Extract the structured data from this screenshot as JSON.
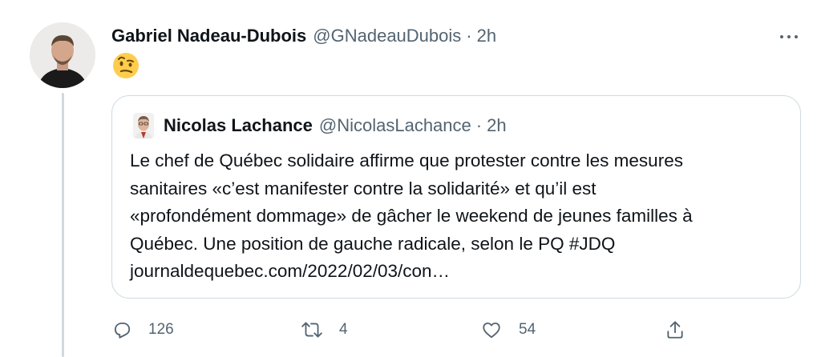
{
  "tweet": {
    "display_name": "Gabriel Nadeau-Dubois",
    "handle": "@GNadeauDubois",
    "separator": "·",
    "time": "2h",
    "emoji": "face-with-raised-eyebrow-emoji",
    "avatar": "profile-photo"
  },
  "quote": {
    "display_name": "Nicolas Lachance",
    "handle": "@NicolasLachance",
    "separator": "·",
    "time": "2h",
    "lines": [
      "Le chef de Québec solidaire affirme que protester contre les mesures",
      "sanitaires «c’est manifester contre la solidarité» et qu’il est",
      "«profondément dommage» de gâcher le weekend de jeunes familles à",
      "Québec. Une position de gauche radicale, selon le PQ #JDQ"
    ],
    "link": "journaldequebec.com/2022/02/03/con…"
  },
  "actions": {
    "reply_count": "126",
    "retweet_count": "4",
    "like_count": "54"
  },
  "icons": {
    "reply": "reply-icon",
    "retweet": "retweet-icon",
    "like": "heart-icon",
    "share": "share-icon",
    "more": "more-icon"
  },
  "colors": {
    "text": "#0f1419",
    "secondary": "#536471",
    "border": "#cfd9de",
    "emoji": "#ffcc4d"
  }
}
